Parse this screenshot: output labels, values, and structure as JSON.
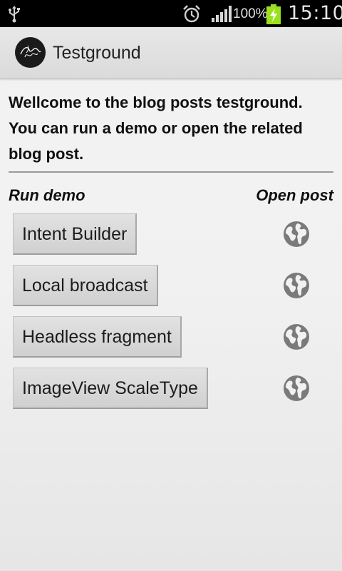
{
  "status_bar": {
    "battery_percent": "100%",
    "time": "15:10",
    "icons": [
      "usb-icon",
      "alarm-icon",
      "signal-icon",
      "battery-charging-icon"
    ]
  },
  "app": {
    "title": "Testground",
    "logo_icon": "app-logo-icon"
  },
  "content": {
    "welcome_text": "Wellcome to the blog posts testground. You can run a demo or open the related blog post.",
    "col_run": "Run demo",
    "col_open": "Open post",
    "rows": [
      {
        "label": "Intent Builder"
      },
      {
        "label": "Local broadcast"
      },
      {
        "label": "Headless fragment"
      },
      {
        "label": "ImageView ScaleType"
      }
    ],
    "open_icon": "globe-icon"
  },
  "colors": {
    "status_bar_bg": "#000000",
    "action_bar_bg": "#e2e2e2",
    "button_bg": "#d9d9d9",
    "globe_icon": "#7a7a7a",
    "text": "#111111"
  }
}
